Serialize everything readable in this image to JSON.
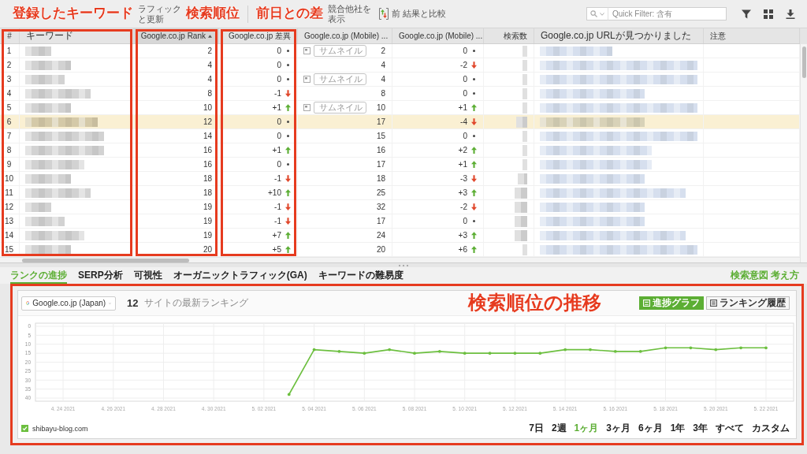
{
  "toolbar": {
    "items": [
      {
        "kind": "annotation",
        "label": "登録したキーワード"
      },
      {
        "kind": "button",
        "lines": [
          "ラフィック",
          "と更新"
        ]
      },
      {
        "kind": "annotation",
        "label": "検索順位"
      },
      {
        "kind": "separator"
      },
      {
        "kind": "annotation",
        "label": "前日との差"
      },
      {
        "kind": "button",
        "lines": [
          "競合他社を",
          "表示"
        ]
      },
      {
        "kind": "compare_button",
        "label": "前 結果と比較"
      }
    ],
    "quick_filter": {
      "placeholder": "Quick Filter: 含有"
    }
  },
  "table": {
    "columns": [
      {
        "label": "#",
        "sorted": false,
        "framed": true
      },
      {
        "label": "キーワード",
        "sorted": false,
        "framed": true,
        "joined": true
      },
      {
        "label": "Google.co.jp Rank",
        "sorted": true,
        "framed": true,
        "joined": false
      },
      {
        "label": "Google.co.jp 差異",
        "sorted": false,
        "framed": true,
        "joined": false
      },
      {
        "label": "Google.co.jp (Mobile) ...",
        "sorted": false,
        "framed": false
      },
      {
        "label": "Google.co.jp (Mobile) ...",
        "sorted": false,
        "framed": false
      },
      {
        "label": "検索数",
        "sorted": false,
        "framed": false
      },
      {
        "label": "Google.co.jp URLが見つかりました",
        "sorted": false,
        "framed": false
      },
      {
        "label": "注意",
        "sorted": false,
        "framed": false
      }
    ],
    "rows": [
      {
        "number": "1",
        "blurred": true,
        "rank": "2",
        "change": {
          "value": "0",
          "kind": "same"
        },
        "serp_feature": "サムネイル",
        "mobile_rank": "2",
        "mobile_change": {
          "value": "0",
          "kind": "same"
        },
        "selected": false
      },
      {
        "number": "2",
        "blurred": true,
        "rank": "4",
        "change": {
          "value": "0",
          "kind": "same"
        },
        "mobile_rank": "4",
        "mobile_change": {
          "value": "-2",
          "kind": "down"
        },
        "selected": false
      },
      {
        "number": "3",
        "blurred": true,
        "rank": "4",
        "change": {
          "value": "0",
          "kind": "same"
        },
        "serp_feature": "サムネイル",
        "mobile_rank": "4",
        "mobile_change": {
          "value": "0",
          "kind": "same"
        },
        "selected": false
      },
      {
        "number": "4",
        "blurred": true,
        "rank": "8",
        "change": {
          "value": "-1",
          "kind": "down"
        },
        "mobile_rank": "8",
        "mobile_change": {
          "value": "0",
          "kind": "same"
        },
        "selected": false
      },
      {
        "number": "5",
        "blurred": true,
        "rank": "10",
        "change": {
          "value": "+1",
          "kind": "up"
        },
        "serp_feature": "サムネイル",
        "mobile_rank": "10",
        "mobile_change": {
          "value": "+1",
          "kind": "up"
        },
        "selected": false
      },
      {
        "number": "6",
        "blurred": true,
        "rank": "12",
        "change": {
          "value": "0",
          "kind": "same"
        },
        "mobile_rank": "17",
        "mobile_change": {
          "value": "-4",
          "kind": "down"
        },
        "selected": true
      },
      {
        "number": "7",
        "blurred": true,
        "rank": "14",
        "change": {
          "value": "0",
          "kind": "same"
        },
        "mobile_rank": "15",
        "mobile_change": {
          "value": "0",
          "kind": "same"
        },
        "selected": false
      },
      {
        "number": "8",
        "blurred": true,
        "rank": "16",
        "change": {
          "value": "+1",
          "kind": "up"
        },
        "mobile_rank": "16",
        "mobile_change": {
          "value": "+2",
          "kind": "up"
        },
        "selected": false
      },
      {
        "number": "9",
        "blurred": true,
        "rank": "16",
        "change": {
          "value": "0",
          "kind": "same"
        },
        "mobile_rank": "17",
        "mobile_change": {
          "value": "+1",
          "kind": "up"
        },
        "selected": false
      },
      {
        "number": "10",
        "blurred": true,
        "rank": "18",
        "change": {
          "value": "-1",
          "kind": "down"
        },
        "mobile_rank": "18",
        "mobile_change": {
          "value": "-3",
          "kind": "down"
        },
        "selected": false
      },
      {
        "number": "11",
        "blurred": true,
        "rank": "18",
        "change": {
          "value": "+10",
          "kind": "up"
        },
        "mobile_rank": "25",
        "mobile_change": {
          "value": "+3",
          "kind": "up"
        },
        "selected": false
      },
      {
        "number": "12",
        "blurred": true,
        "rank": "19",
        "change": {
          "value": "-1",
          "kind": "down"
        },
        "mobile_rank": "32",
        "mobile_change": {
          "value": "-2",
          "kind": "down"
        },
        "selected": false
      },
      {
        "number": "13",
        "blurred": true,
        "rank": "19",
        "change": {
          "value": "-1",
          "kind": "down"
        },
        "mobile_rank": "17",
        "mobile_change": {
          "value": "0",
          "kind": "same"
        },
        "selected": false
      },
      {
        "number": "14",
        "blurred": true,
        "rank": "19",
        "change": {
          "value": "+7",
          "kind": "up"
        },
        "mobile_rank": "24",
        "mobile_change": {
          "value": "+3",
          "kind": "up"
        },
        "selected": false
      },
      {
        "number": "15",
        "blurred": true,
        "rank": "20",
        "change": {
          "value": "+5",
          "kind": "up"
        },
        "mobile_rank": "20",
        "mobile_change": {
          "value": "+6",
          "kind": "up"
        },
        "selected": false
      }
    ]
  },
  "bottom_tabs": {
    "tabs": [
      {
        "label": "ランクの進捗",
        "selected": true
      },
      {
        "label": "SERP分析",
        "selected": false
      },
      {
        "label": "可視性",
        "selected": false
      },
      {
        "label": "オーガニックトラフィック(GA)",
        "selected": false
      },
      {
        "label": "キーワードの難易度",
        "selected": false
      }
    ],
    "link": "検索意図 考え方"
  },
  "rank_panel": {
    "annotation": "検索順位の推移",
    "engine_select": {
      "value": "Google.co.jp (Japan)"
    },
    "latest_rank": "12",
    "latest_rank_label": "サイトの最新ランキング",
    "view_buttons": [
      {
        "label": "進捗グラフ",
        "selected": true
      },
      {
        "label": "ランキング履歴",
        "selected": false
      }
    ],
    "chart_data": {
      "type": "line",
      "grid": true,
      "categories": [
        "4. 24 2021",
        null,
        "4. 26 2021",
        null,
        "4. 28 2021",
        null,
        "4. 30 2021",
        null,
        "5. 02 2021",
        null,
        "5. 04 2021",
        null,
        "5. 06 2021",
        null,
        "5. 08 2021",
        null,
        "5. 10 2021",
        null,
        "5. 12 2021",
        null,
        "5. 14 2021",
        null,
        "5. 16 2021",
        null,
        "5. 18 2021",
        null,
        "5. 20 2021",
        null,
        "5. 22 2021"
      ],
      "yticks": [
        0,
        5,
        10,
        15,
        20,
        25,
        30,
        35,
        40
      ],
      "ylim": [
        40,
        0
      ],
      "series": [
        {
          "name": "shibayu-blog.com",
          "color": "#6cbf3f",
          "values": [
            null,
            null,
            null,
            null,
            null,
            null,
            null,
            null,
            null,
            38,
            13,
            14,
            15,
            13,
            15,
            14,
            15,
            15,
            15,
            15,
            13,
            13,
            14,
            14,
            12,
            12,
            13,
            12,
            12
          ]
        }
      ]
    },
    "legend": [
      {
        "checked": true
      }
    ],
    "periods": [
      {
        "label": "7日",
        "selected": false
      },
      {
        "label": "2週",
        "selected": false
      },
      {
        "label": "1ヶ月",
        "selected": true
      },
      {
        "label": "3ヶ月",
        "selected": false
      },
      {
        "label": "6ヶ月",
        "selected": false
      },
      {
        "label": "1年",
        "selected": false
      },
      {
        "label": "3年",
        "selected": false
      },
      {
        "label": "すべて",
        "selected": false
      },
      {
        "label": "カスタム",
        "selected": false
      }
    ]
  }
}
